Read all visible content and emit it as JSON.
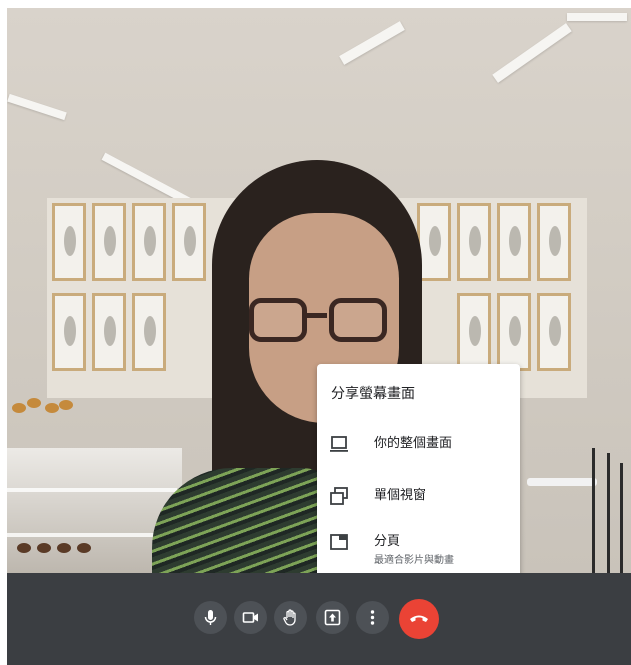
{
  "share_menu": {
    "title": "分享螢幕畫面",
    "items": [
      {
        "label": "你的整個畫面",
        "sublabel": "",
        "icon": "monitor-icon"
      },
      {
        "label": "單個視窗",
        "sublabel": "",
        "icon": "window-icon"
      },
      {
        "label": "分頁",
        "sublabel": "最適合影片與動畫",
        "icon": "tab-icon"
      }
    ]
  },
  "controls": [
    {
      "icon": "microphone-icon"
    },
    {
      "icon": "camera-icon"
    },
    {
      "icon": "raise-hand-icon"
    },
    {
      "icon": "present-screen-icon"
    },
    {
      "icon": "more-options-icon"
    },
    {
      "icon": "end-call-icon",
      "color": "#ea4335"
    }
  ],
  "colors": {
    "control_bar": "#3b3e42",
    "button_bg": "#4d5156",
    "end_call": "#ea4335",
    "menu_bg": "#ffffff"
  }
}
